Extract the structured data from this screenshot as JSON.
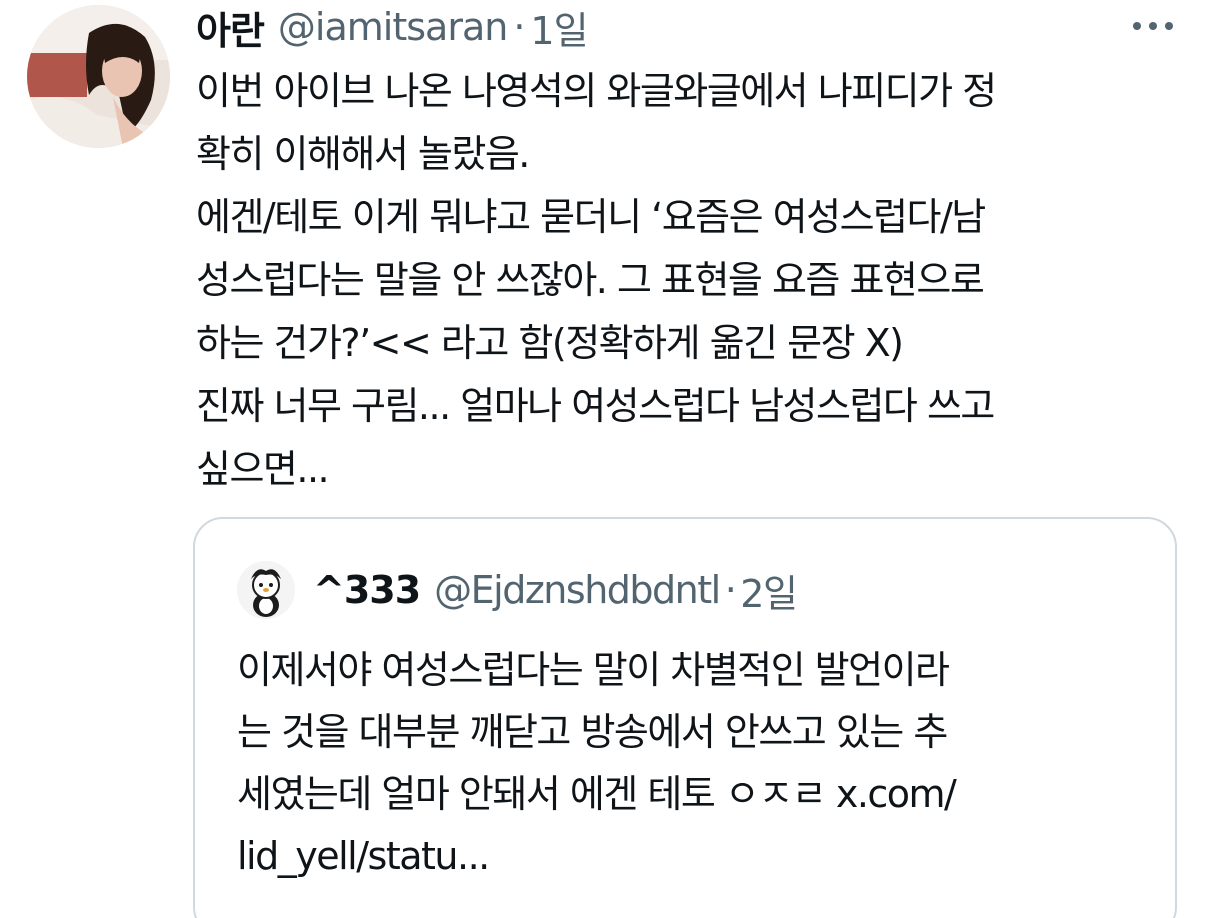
{
  "tweet": {
    "author_name": "아란",
    "author_handle": "@iamitsaran",
    "separator": "·",
    "time": "1일",
    "text_lines": [
      "이번 아이브 나온 나영석의 와글와글에서 나피디가 정",
      "확히 이해해서 놀랐음.",
      "에겐/테토 이게 뭐냐고 묻더니 ‘요즘은 여성스럽다/남",
      "성스럽다는 말을 안 쓰잖아. 그 표현을 요즘 표현으로",
      "하는 건가?’<< 라고 함(정확하게 옮긴 문장 X)",
      "진짜 너무 구림... 얼마나 여성스럽다 남성스럽다 쓰고",
      "싶으면..."
    ]
  },
  "quoted_tweet": {
    "author_name": "^333",
    "author_handle": "@Ejdznshdbdntl",
    "separator": "·",
    "time": "2일",
    "text_lines": [
      "이제서야 여성스럽다는 말이 차별적인 발언이라",
      "는 것을 대부분 깨닫고 방송에서 안쓰고 있는 추",
      "세였는데 얼마 안돼서 에겐 테토 ㅇㅈㄹ x.com/",
      "lid_yell/statu..."
    ]
  },
  "icons": {
    "more": "more-horizontal-icon",
    "avatar": "profile-photo",
    "quoted_avatar": "cartoon-character-avatar"
  },
  "colors": {
    "text_primary": "#0f1419",
    "text_secondary": "#536471",
    "card_border": "#cfd9de"
  }
}
